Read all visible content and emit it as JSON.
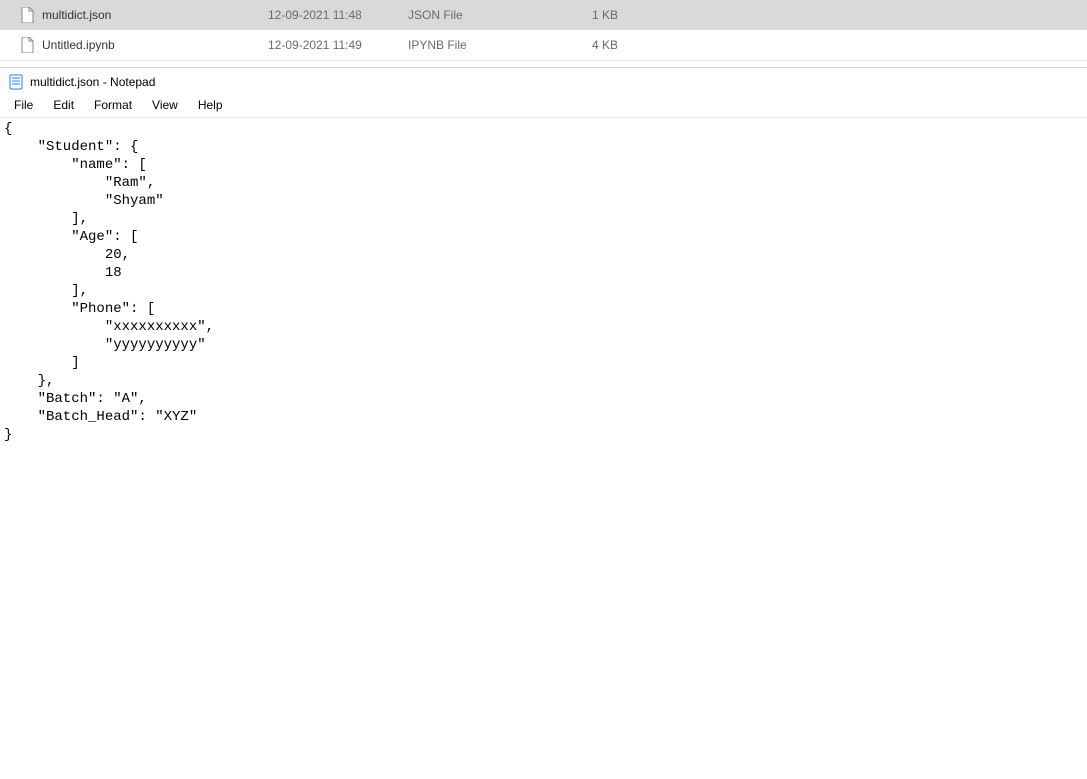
{
  "files": [
    {
      "name": "multidict.json",
      "date": "12-09-2021 11:48",
      "type": "JSON File",
      "size": "1 KB",
      "selected": true
    },
    {
      "name": "Untitled.ipynb",
      "date": "12-09-2021 11:49",
      "type": "IPYNB File",
      "size": "4 KB",
      "selected": false
    }
  ],
  "notepad": {
    "title": "multidict.json - Notepad",
    "menus": {
      "file": "File",
      "edit": "Edit",
      "format": "Format",
      "view": "View",
      "help": "Help"
    },
    "content": "{\n    \"Student\": {\n        \"name\": [\n            \"Ram\",\n            \"Shyam\"\n        ],\n        \"Age\": [\n            20,\n            18\n        ],\n        \"Phone\": [\n            \"xxxxxxxxxx\",\n            \"yyyyyyyyyy\"\n        ]\n    },\n    \"Batch\": \"A\",\n    \"Batch_Head\": \"XYZ\"\n}"
  }
}
